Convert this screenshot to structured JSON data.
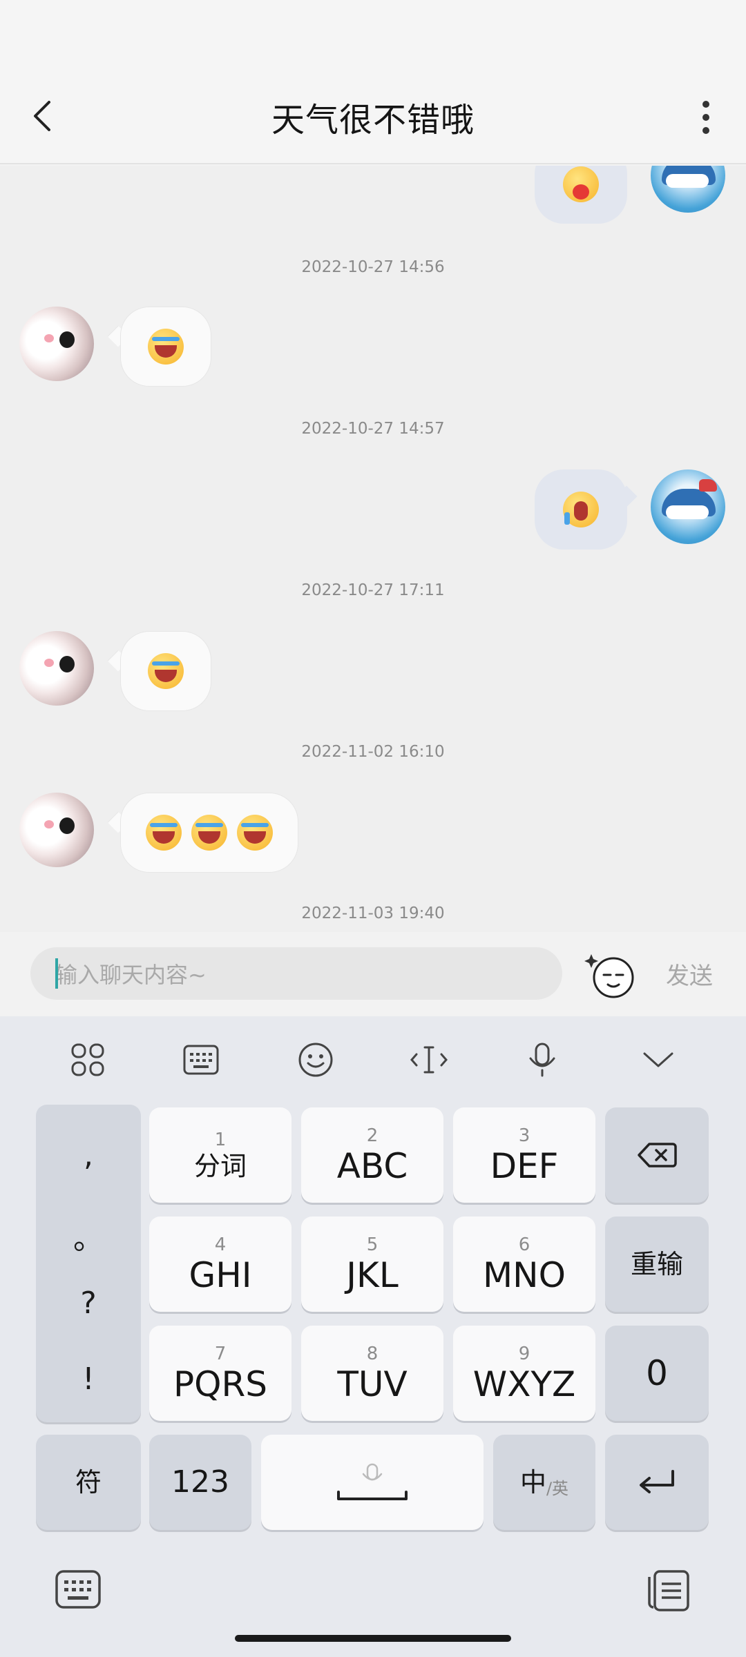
{
  "header": {
    "title": "天气很不错哦"
  },
  "messages": {
    "ts1": "2022-10-27 14:56",
    "ts2": "2022-10-27 14:57",
    "ts3": "2022-10-27 17:11",
    "ts4": "2022-11-02 16:10",
    "ts5": "2022-11-03 19:40"
  },
  "input": {
    "placeholder": "输入聊天内容~",
    "send_label": "发送"
  },
  "keyboard": {
    "punct": [
      ",",
      "。",
      "?",
      "!"
    ],
    "rows": [
      {
        "k1": {
          "num": "1",
          "label": "分词"
        },
        "k2": {
          "num": "2",
          "label": "ABC"
        },
        "k3": {
          "num": "3",
          "label": "DEF"
        }
      },
      {
        "k1": {
          "num": "4",
          "label": "GHI"
        },
        "k2": {
          "num": "5",
          "label": "JKL"
        },
        "k3": {
          "num": "6",
          "label": "MNO"
        }
      },
      {
        "k1": {
          "num": "7",
          "label": "PQRS"
        },
        "k2": {
          "num": "8",
          "label": "TUV"
        },
        "k3": {
          "num": "9",
          "label": "WXYZ"
        }
      }
    ],
    "reinput": "重输",
    "zero": "0",
    "symbols": "符",
    "num_mode": "123",
    "lang_main": "中",
    "lang_sub": "/英"
  }
}
